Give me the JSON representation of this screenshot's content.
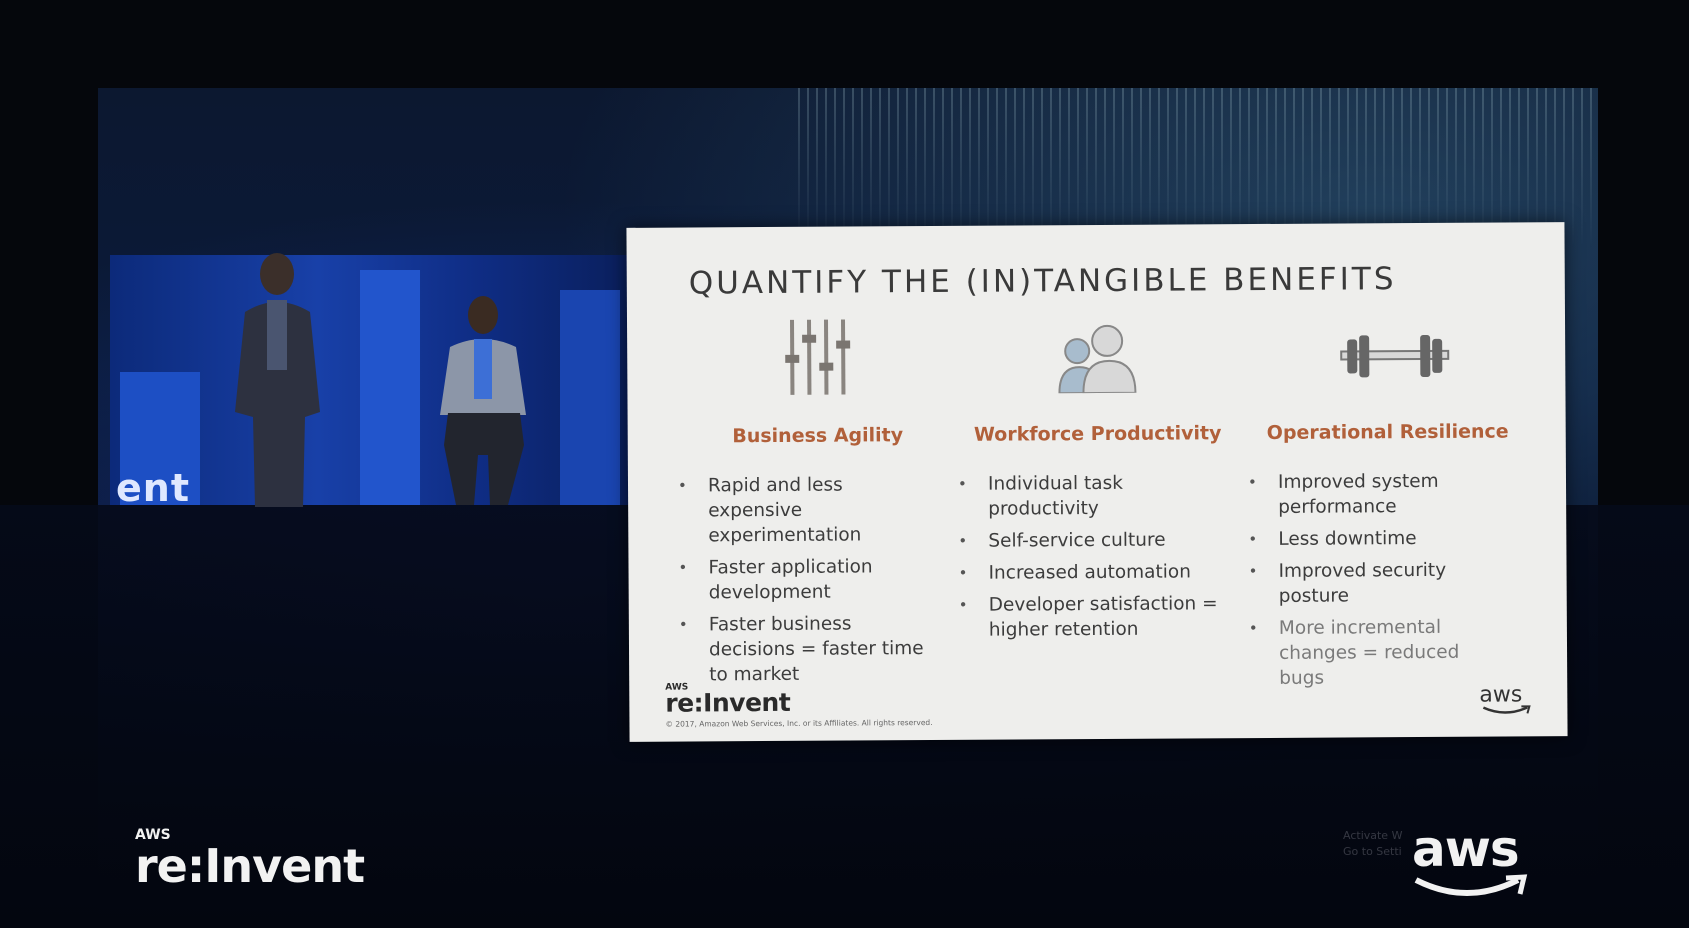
{
  "slide": {
    "title": "QUANTIFY THE (IN)TANGIBLE BENEFITS",
    "columns": [
      {
        "icon": "sliders-icon",
        "heading": "Business Agility",
        "bullets": [
          "Rapid and less expensive experimentation",
          "Faster application development",
          "Faster business decisions = faster time to market"
        ]
      },
      {
        "icon": "people-icon",
        "heading": "Workforce Productivity",
        "bullets": [
          "Individual task productivity",
          "Self-service culture",
          "Increased automation",
          "Developer satisfaction = higher retention"
        ]
      },
      {
        "icon": "barbell-icon",
        "heading": "Operational Resilience",
        "bullets": [
          "Improved system performance",
          "Less downtime",
          "Improved security posture",
          "More incremental changes = reduced bugs"
        ]
      }
    ],
    "brand_small": "AWS",
    "brand_event": "re:Invent",
    "copyright": "© 2017, Amazon Web Services, Inc. or its Affiliates. All rights reserved.",
    "aws_logo": "aws"
  },
  "stage": {
    "backdrop_text": "ent",
    "event_logo_small": "AWS",
    "event_logo": "re:Invent",
    "aws_logo": "aws",
    "overlay_line1": "Activate W",
    "overlay_line2": "Go to Setti"
  },
  "colors": {
    "slide_bg": "#eeeeec",
    "heading": "#b1603a",
    "stage_blue": "#1d4fc4"
  }
}
